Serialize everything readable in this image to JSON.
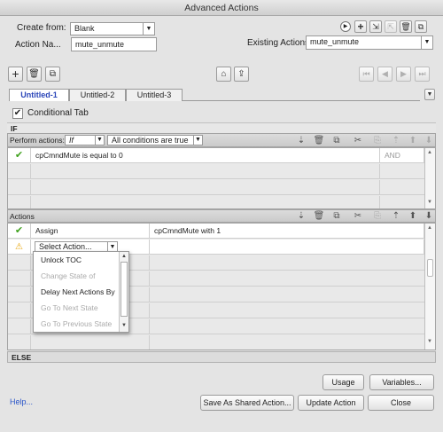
{
  "window": {
    "title": "Advanced Actions"
  },
  "top": {
    "create_from_label": "Create from:",
    "create_from_value": "Blank",
    "action_name_label": "Action Na...",
    "action_name_value": "mute_unmute",
    "existing_actions_label": "Existing Actions:",
    "existing_actions_value": "mute_unmute"
  },
  "tabs": [
    {
      "label": "Untitled-1"
    },
    {
      "label": "Untitled-2"
    },
    {
      "label": "Untitled-3"
    }
  ],
  "conditional": {
    "label": "Conditional Tab",
    "checked": true
  },
  "if_section": {
    "label": "IF",
    "perform_actions_label": "Perform actions:",
    "if_value": "If",
    "conditions_value": "All conditions are true",
    "rows": [
      {
        "status": "check",
        "condition": "cpCmndMute   is equal to   0",
        "op": "AND"
      }
    ]
  },
  "actions_section": {
    "label": "Actions",
    "rows": [
      {
        "status": "check",
        "action": "Assign",
        "detail": "cpCmndMute   with   1"
      },
      {
        "status": "warn",
        "action": "Select Action...",
        "detail": ""
      }
    ]
  },
  "dropdown": {
    "items": [
      {
        "label": "Unlock TOC",
        "enabled": true
      },
      {
        "label": "Change State of",
        "enabled": false
      },
      {
        "label": "Delay Next Actions By",
        "enabled": true
      },
      {
        "label": "Go To Next State",
        "enabled": false
      },
      {
        "label": "Go To Previous State",
        "enabled": false
      }
    ]
  },
  "else_section": {
    "label": "ELSE"
  },
  "footer": {
    "usage": "Usage",
    "variables": "Variables...",
    "help": "Help...",
    "save_shared": "Save As Shared Action...",
    "update": "Update Action",
    "close": "Close"
  },
  "colors": {
    "check": "#3fa11d",
    "warn": "#e8a60c",
    "link": "#2a55c9",
    "active_tab": "#2a45b8"
  }
}
